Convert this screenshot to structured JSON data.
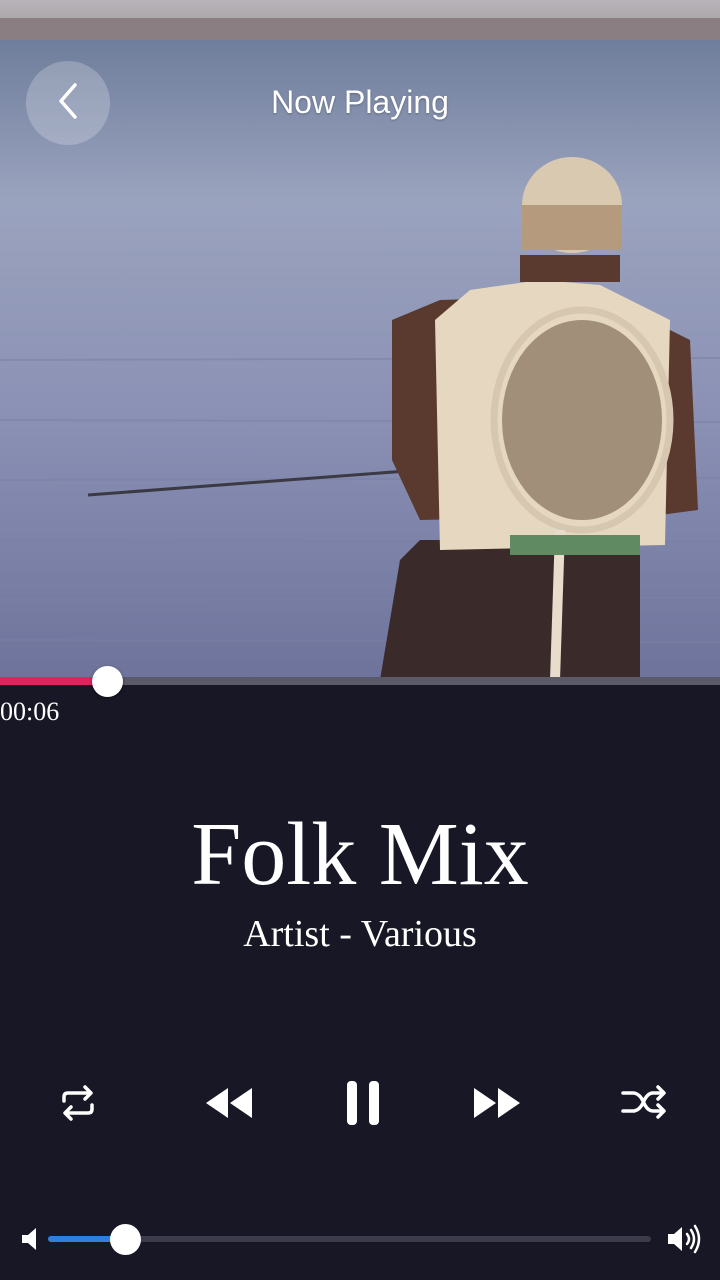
{
  "header": {
    "title": "Now Playing",
    "back_icon": "chevron-left-icon"
  },
  "track": {
    "title": "Folk Mix",
    "artist": "Artist - Various",
    "elapsed": "00:06"
  },
  "controls": {
    "repeat_icon": "repeat-icon",
    "rewind_icon": "rewind-icon",
    "pause_icon": "pause-icon",
    "fast_forward_icon": "fast-forward-icon",
    "shuffle_icon": "shuffle-icon"
  },
  "colors": {
    "background": "#171726",
    "progress_accent": "#e0245e",
    "volume_accent": "#2f7fe0"
  },
  "playback_progress_fraction": 0.15,
  "volume_level_fraction": 0.13
}
